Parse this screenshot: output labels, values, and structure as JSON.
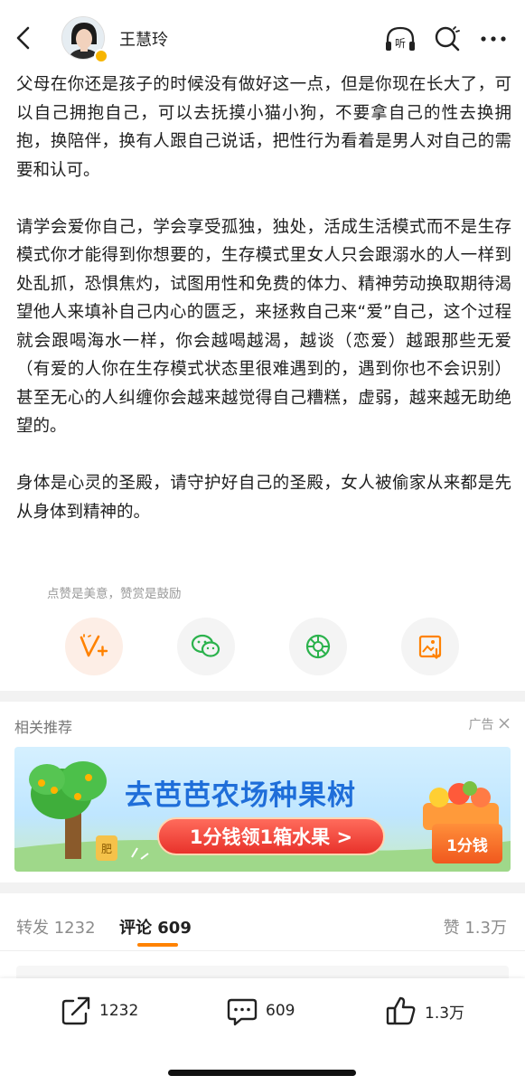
{
  "header": {
    "username": "王慧玲",
    "listen_icon_label": "听"
  },
  "article": {
    "paragraphs": [
      "父母在你还是孩子的时候没有做好这一点，但是你现在长大了，可以自己拥抱自己，可以去抚摸小猫小狗，不要拿自己的性去换拥抱，换陪伴，换有人跟自己说话，把性行为看着是男人对自己的需要和认可。",
      "请学会爱你自己，学会享受孤独，独处，活成生活模式而不是生存模式你才能得到你想要的，生存模式里女人只会跟溺水的人一样到处乱抓，恐惧焦灼，试图用性和免费的体力、精神劳动换取期待渴望他人来填补自己内心的匮乏，来拯救自己来“爱”自己，这个过程就会跟喝海水一样，你会越喝越渴，越谈（恋爱）越跟那些无爱（有爱的人你在生存模式状态里很难遇到的，遇到你也不会识别）甚至无心的人纠缠你会越来越觉得自己糟糕，虚弱，越来越无助绝望的。",
      "身体是心灵的圣殿，请守护好自己的圣殿，女人被偷家从来都是先从身体到精神的。"
    ]
  },
  "actions": {
    "hint": "点赞是美意，赞赏是鼓励"
  },
  "recommend": {
    "title": "相关推荐",
    "ad_label": "广告"
  },
  "banner": {
    "title": "去芭芭农场种果树",
    "button": "1分钱领1箱水果 >",
    "price_tag": "1分钱",
    "fertilizer": "肥"
  },
  "tabs": {
    "repost_label": "转发",
    "repost_count": "1232",
    "comment_label": "评论",
    "comment_count": "609",
    "like_label": "赞",
    "like_count": "1.3万"
  },
  "bottom_bar": {
    "share_count": "1232",
    "comment_count": "609",
    "like_count": "1.3万"
  },
  "colors": {
    "accent": "#ff8200",
    "wechat_green": "#2bb24c",
    "banner_blue": "#1f6ed9"
  }
}
